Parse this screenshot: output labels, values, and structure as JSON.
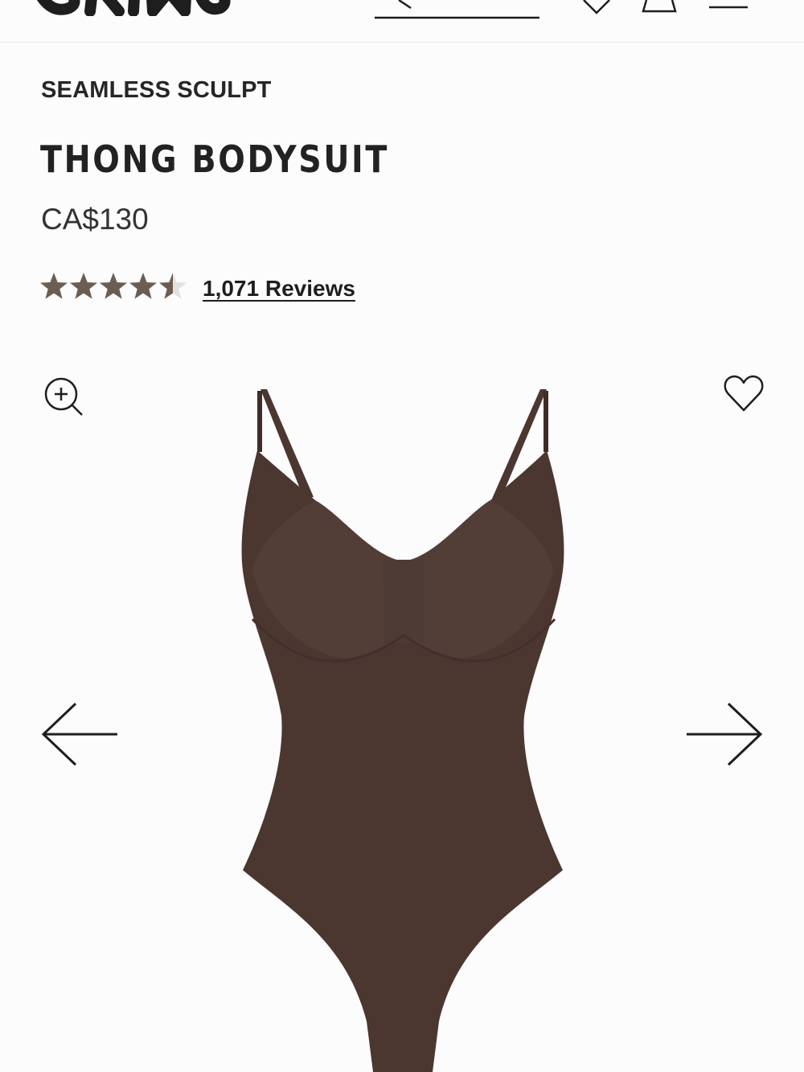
{
  "header": {
    "logo_icon": "skims-logo",
    "search_icon": "search-back-arrow-icon",
    "wishlist_icon": "heart-icon",
    "bag_icon": "shopping-bag-icon",
    "menu_icon": "hamburger-menu-icon"
  },
  "product": {
    "collection": "SEAMLESS SCULPT",
    "title": "THONG BODYSUIT",
    "price": "CA$130",
    "rating": 4.5,
    "rating_max": 5,
    "reviews_label": "1,071 Reviews"
  },
  "gallery": {
    "zoom_icon": "zoom-in-icon",
    "favorite_icon": "heart-outline-icon",
    "prev_icon": "arrow-left-icon",
    "next_icon": "arrow-right-icon",
    "image_subject": "thong-bodysuit-image",
    "product_color": "#4b3630",
    "star_color": "#6b5d52"
  }
}
